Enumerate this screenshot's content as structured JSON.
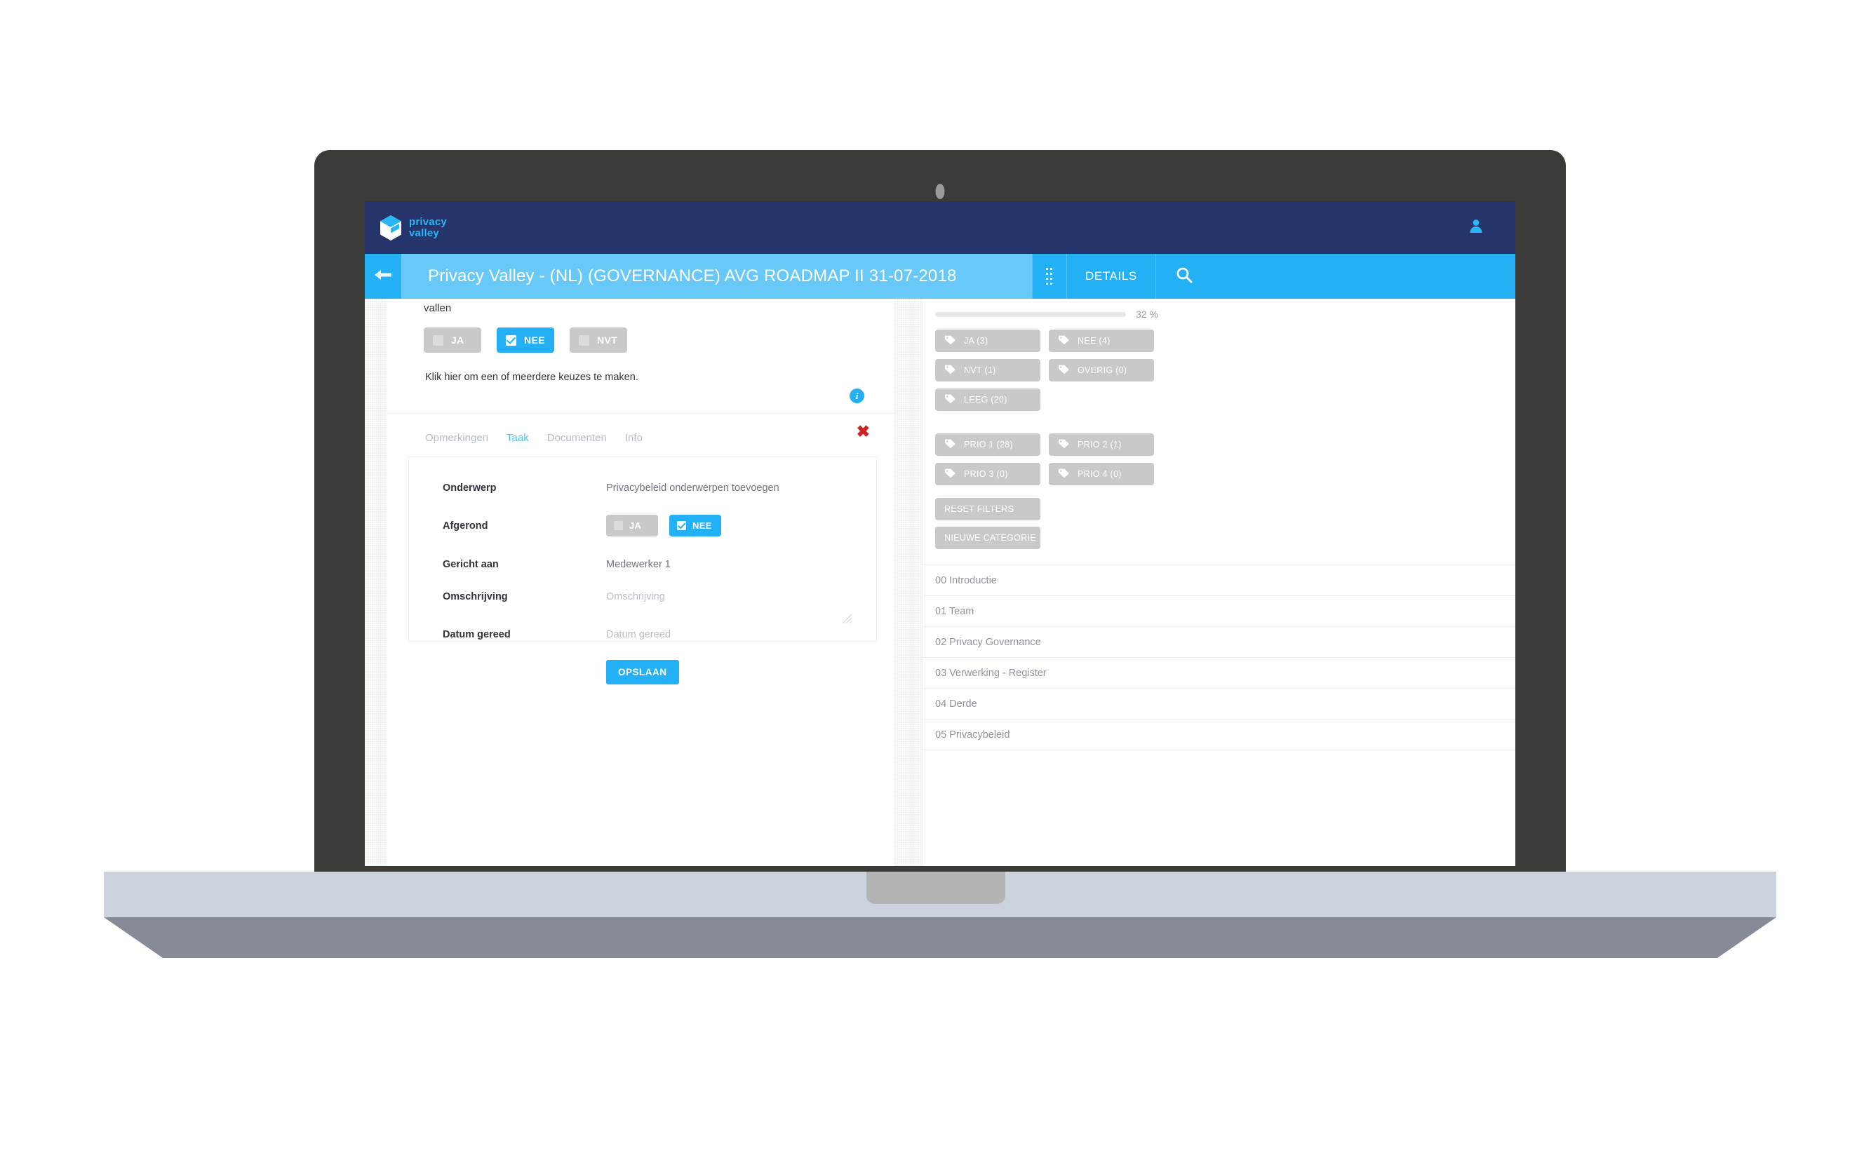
{
  "brand": {
    "name_line1": "privacy",
    "name_line2": "valley",
    "accent": "#29b6f6",
    "navy": "#25346b",
    "primary": "#23b0f5"
  },
  "topbar": {
    "user_icon": "user-icon"
  },
  "titlebar": {
    "collapse_icon": "arrow-left-icon",
    "title": "Privacy Valley - (NL) (GOVERNANCE) AVG ROADMAP II 31-07-2018",
    "grip_icon": "drag-grip-icon",
    "details_label": "DETAILS",
    "search_icon": "search-icon"
  },
  "question": {
    "tail_text": "vallen",
    "options": [
      {
        "label": "JA",
        "selected": false
      },
      {
        "label": "NEE",
        "selected": true
      },
      {
        "label": "NVT",
        "selected": false
      }
    ],
    "hint": "Klik hier om een of meerdere keuzes te maken.",
    "info_icon": "info-icon"
  },
  "tabs": [
    {
      "label": "Opmerkingen",
      "active": false
    },
    {
      "label": "Taak",
      "active": true
    },
    {
      "label": "Documenten",
      "active": false
    },
    {
      "label": "Info",
      "active": false
    }
  ],
  "close_icon_label": "✖",
  "task_form": {
    "onderwerp_label": "Onderwerp",
    "onderwerp_value": "Privacybeleid onderwerpen toevoegen",
    "afgerond_label": "Afgerond",
    "afgerond_options": [
      {
        "label": "JA",
        "selected": false
      },
      {
        "label": "NEE",
        "selected": true
      }
    ],
    "gericht_label": "Gericht aan",
    "gericht_value": "Medewerker 1",
    "omschrijving_label": "Omschrijving",
    "omschrijving_placeholder": "Omschrijving",
    "datum_label": "Datum gereed",
    "datum_placeholder": "Datum gereed",
    "save_label": "OPSLAAN",
    "resize_icon": "resize-handle-icon"
  },
  "sidebar": {
    "progress_percent": 32,
    "progress_text": "32 %",
    "tags": [
      {
        "label": "JA (3)"
      },
      {
        "label": "NEE (4)"
      },
      {
        "label": "NVT (1)"
      },
      {
        "label": "OVERIG (0)"
      },
      {
        "label": "LEEG (20)"
      }
    ],
    "prio_tags": [
      {
        "label": "PRIO 1 (28)"
      },
      {
        "label": "PRIO 2 (1)"
      },
      {
        "label": "PRIO 3 (0)"
      },
      {
        "label": "PRIO 4 (0)"
      }
    ],
    "reset_label": "RESET FILTERS",
    "new_category_label": "NIEUWE CATEGORIE",
    "categories": [
      {
        "label": "00 Introductie"
      },
      {
        "label": "01 Team"
      },
      {
        "label": "02 Privacy Governance"
      },
      {
        "label": "03 Verwerking - Register"
      },
      {
        "label": "04 Derde"
      },
      {
        "label": "05 Privacybeleid"
      }
    ]
  }
}
